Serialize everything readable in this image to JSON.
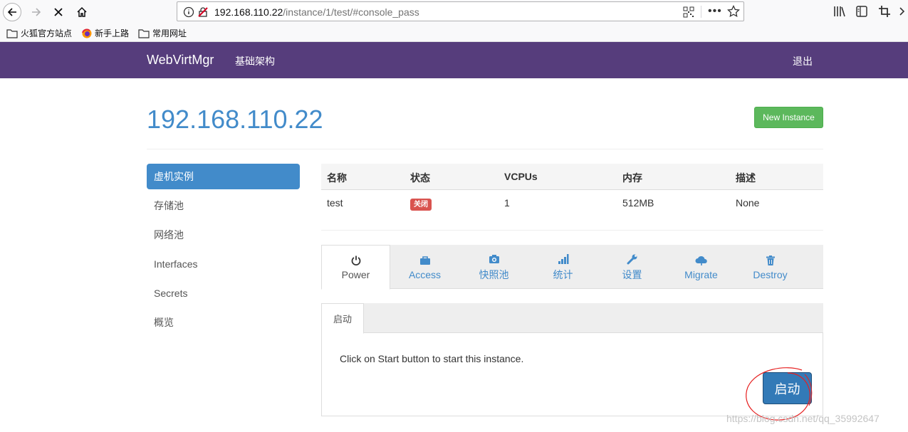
{
  "browser": {
    "url_host": "192.168.110.22",
    "url_path": "/instance/1/test/#console_pass",
    "bookmarks": [
      "火狐官方站点",
      "新手上路",
      "常用网址"
    ]
  },
  "navbar": {
    "brand": "WebVirtMgr",
    "infra_link": "基础架构",
    "logout": "退出",
    "color": "#563d7c"
  },
  "page": {
    "title": "192.168.110.22",
    "new_instance": "New Instance"
  },
  "sidebar": {
    "items": [
      {
        "label": "虚机实例",
        "active": true
      },
      {
        "label": "存储池"
      },
      {
        "label": "网络池"
      },
      {
        "label": "Interfaces"
      },
      {
        "label": "Secrets"
      },
      {
        "label": "概览"
      }
    ]
  },
  "table": {
    "headers": [
      "名称",
      "状态",
      "VCPUs",
      "内存",
      "描述"
    ],
    "row": {
      "name": "test",
      "status": "关闭",
      "vcpus": "1",
      "memory": "512MB",
      "desc": "None"
    }
  },
  "tabs": [
    {
      "label": "Power",
      "icon": "power-icon",
      "active": true
    },
    {
      "label": "Access",
      "icon": "briefcase-icon"
    },
    {
      "label": "快照池",
      "icon": "camera-icon"
    },
    {
      "label": "统计",
      "icon": "signal-icon"
    },
    {
      "label": "设置",
      "icon": "wrench-icon"
    },
    {
      "label": "Migrate",
      "icon": "cloud-upload-icon"
    },
    {
      "label": "Destroy",
      "icon": "trash-icon"
    }
  ],
  "power": {
    "subtab": "启动",
    "message": "Click on Start button to start this instance.",
    "start_button": "启动"
  },
  "watermark": "https://blog.csdn.net/qq_35992647"
}
